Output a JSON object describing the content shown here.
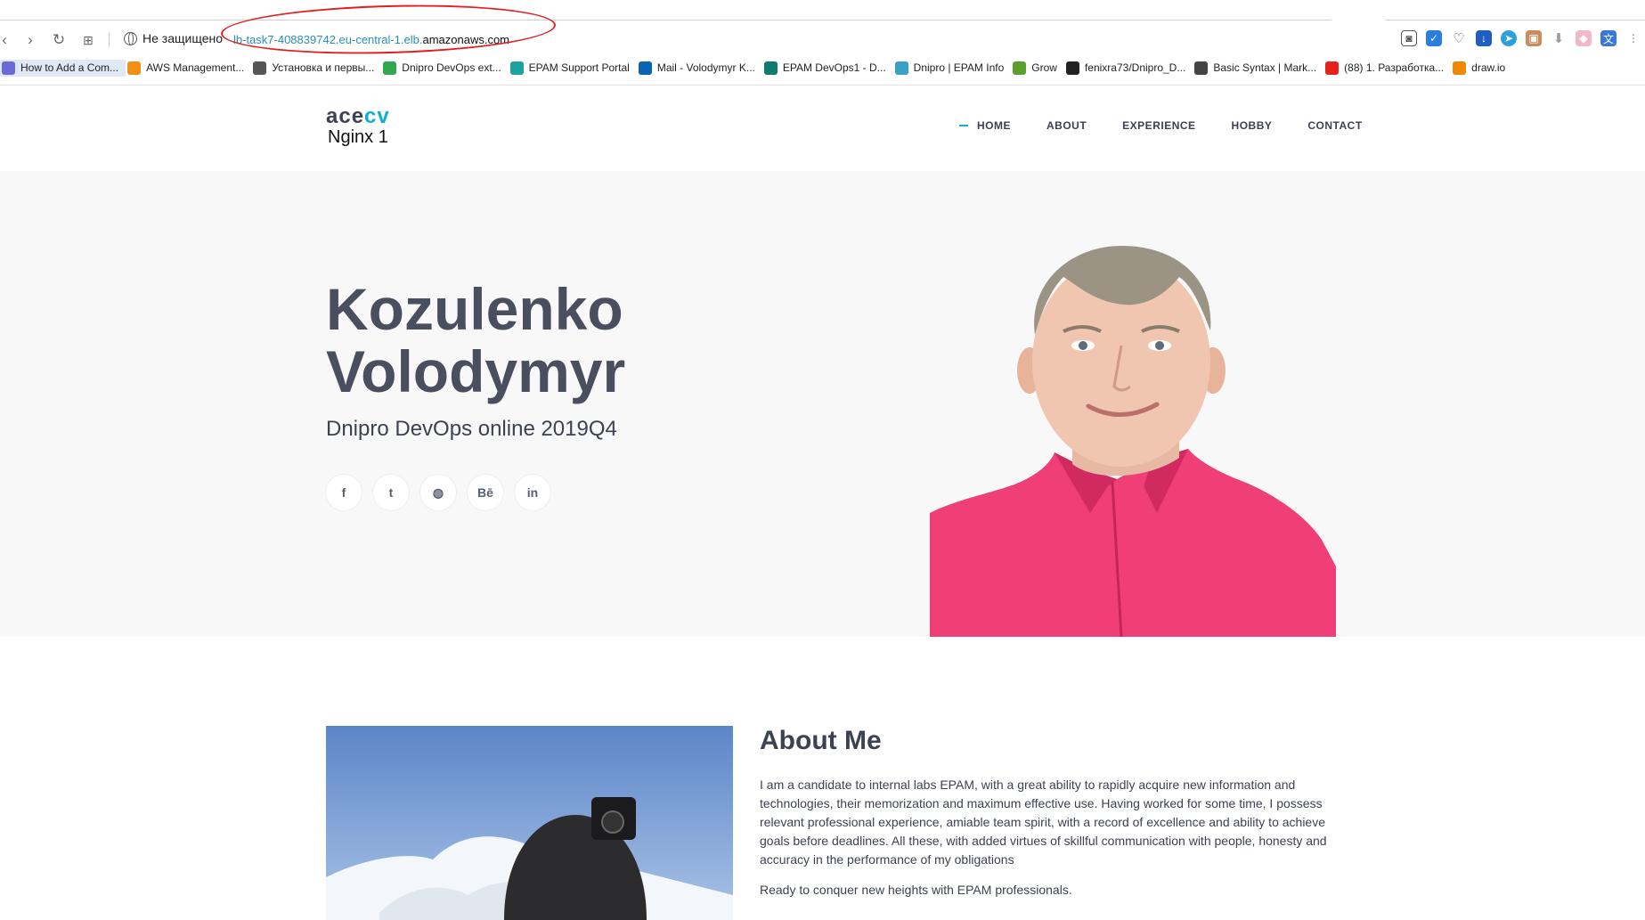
{
  "browser": {
    "nav_icons": [
      "back-icon",
      "forward-icon",
      "reload-icon",
      "apps-grid-icon"
    ],
    "security_label": "Не защищено",
    "url_path": "lb-task7-408839742.eu-central-1.elb.",
    "url_domain": "amazonaws.com",
    "annotation_color": "#e02020",
    "extensions": [
      "camera-icon",
      "shield-check-icon",
      "heart-icon",
      "download-icon",
      "telegram-icon",
      "extension-icon",
      "download-arrow-icon",
      "cube-icon",
      "translate-icon"
    ],
    "bookmarks": [
      {
        "label": "How to Add a Com...",
        "icon": "gitlab-icon",
        "color": "#6b6bd6"
      },
      {
        "label": "AWS Management...",
        "icon": "aws-icon",
        "color": "#f29111"
      },
      {
        "label": "Установка и первы...",
        "icon": "globe-icon",
        "color": "#555555"
      },
      {
        "label": "Dnipro DevOps ext...",
        "icon": "drive-icon",
        "color": "#2fa84f"
      },
      {
        "label": "EPAM Support Portal",
        "icon": "epam-icon",
        "color": "#1ba39c"
      },
      {
        "label": "Mail - Volodymyr K...",
        "icon": "outlook-icon",
        "color": "#0a64b4"
      },
      {
        "label": "EPAM DevOps1 - D...",
        "icon": "sharepoint-icon",
        "color": "#0f7b6c"
      },
      {
        "label": "Dnipro | EPAM Info",
        "icon": "epam-info-icon",
        "color": "#39a0c8"
      },
      {
        "label": "Grow",
        "icon": "grow-icon",
        "color": "#5aa02c"
      },
      {
        "label": "fenixra73/Dnipro_D...",
        "icon": "github-icon",
        "color": "#222222"
      },
      {
        "label": "Basic Syntax | Mark...",
        "icon": "markdown-icon",
        "color": "#444444"
      },
      {
        "label": "(88) 1. Разработка...",
        "icon": "youtube-icon",
        "color": "#e62117"
      },
      {
        "label": "draw.io",
        "icon": "drawio-icon",
        "color": "#f08705"
      }
    ]
  },
  "site": {
    "logo_main_a": "ace",
    "logo_main_b": "cv",
    "logo_sub": "Nginx 1",
    "accent": "#0fb0d0",
    "nav": [
      "HOME",
      "ABOUT",
      "EXPERIENCE",
      "HOBBY",
      "CONTACT"
    ],
    "active_nav": "HOME"
  },
  "hero": {
    "name_line1": "Kozulenko",
    "name_line2": "Volodymyr",
    "subtitle": "Dnipro DevOps online 2019Q4",
    "socials": [
      {
        "icon": "facebook-icon",
        "glyph": "f"
      },
      {
        "icon": "twitter-icon",
        "glyph": "t"
      },
      {
        "icon": "dribbble-icon",
        "glyph": "◍"
      },
      {
        "icon": "behance-icon",
        "glyph": "Bē"
      },
      {
        "icon": "linkedin-icon",
        "glyph": "in"
      }
    ]
  },
  "about": {
    "title": "About Me",
    "paragraph1": "I am a candidate to internal labs EPAM, with a great ability to rapidly acquire new information and technologies, their memorization and maximum effective use. Having worked for some time, I possess relevant professional experience, amiable team spirit, with a record of excellence and ability to achieve goals before deadlines. All these, with added virtues of skillful communication with people, honesty and accuracy in the performance of my obligations",
    "paragraph2": "Ready to conquer new heights with EPAM professionals."
  }
}
